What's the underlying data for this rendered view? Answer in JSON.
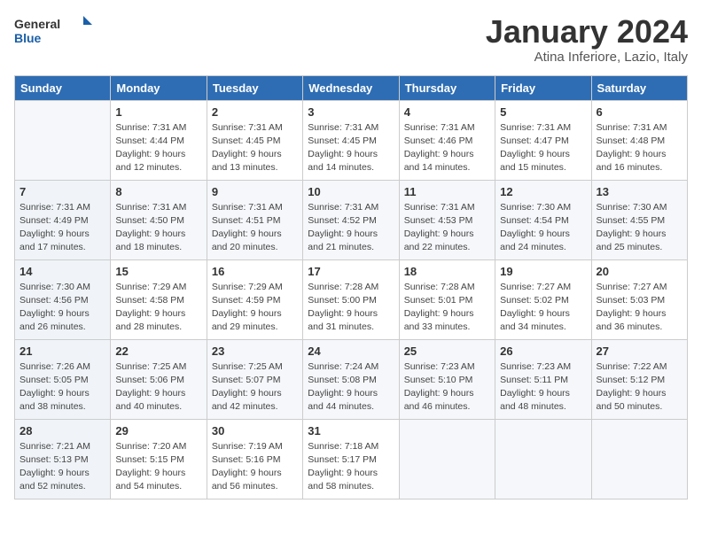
{
  "header": {
    "logo_line1": "General",
    "logo_line2": "Blue",
    "month_title": "January 2024",
    "location": "Atina Inferiore, Lazio, Italy"
  },
  "weekdays": [
    "Sunday",
    "Monday",
    "Tuesday",
    "Wednesday",
    "Thursday",
    "Friday",
    "Saturday"
  ],
  "weeks": [
    [
      {
        "day": "",
        "content": ""
      },
      {
        "day": "1",
        "content": "Sunrise: 7:31 AM\nSunset: 4:44 PM\nDaylight: 9 hours\nand 12 minutes."
      },
      {
        "day": "2",
        "content": "Sunrise: 7:31 AM\nSunset: 4:45 PM\nDaylight: 9 hours\nand 13 minutes."
      },
      {
        "day": "3",
        "content": "Sunrise: 7:31 AM\nSunset: 4:45 PM\nDaylight: 9 hours\nand 14 minutes."
      },
      {
        "day": "4",
        "content": "Sunrise: 7:31 AM\nSunset: 4:46 PM\nDaylight: 9 hours\nand 14 minutes."
      },
      {
        "day": "5",
        "content": "Sunrise: 7:31 AM\nSunset: 4:47 PM\nDaylight: 9 hours\nand 15 minutes."
      },
      {
        "day": "6",
        "content": "Sunrise: 7:31 AM\nSunset: 4:48 PM\nDaylight: 9 hours\nand 16 minutes."
      }
    ],
    [
      {
        "day": "7",
        "content": "Sunrise: 7:31 AM\nSunset: 4:49 PM\nDaylight: 9 hours\nand 17 minutes."
      },
      {
        "day": "8",
        "content": "Sunrise: 7:31 AM\nSunset: 4:50 PM\nDaylight: 9 hours\nand 18 minutes."
      },
      {
        "day": "9",
        "content": "Sunrise: 7:31 AM\nSunset: 4:51 PM\nDaylight: 9 hours\nand 20 minutes."
      },
      {
        "day": "10",
        "content": "Sunrise: 7:31 AM\nSunset: 4:52 PM\nDaylight: 9 hours\nand 21 minutes."
      },
      {
        "day": "11",
        "content": "Sunrise: 7:31 AM\nSunset: 4:53 PM\nDaylight: 9 hours\nand 22 minutes."
      },
      {
        "day": "12",
        "content": "Sunrise: 7:30 AM\nSunset: 4:54 PM\nDaylight: 9 hours\nand 24 minutes."
      },
      {
        "day": "13",
        "content": "Sunrise: 7:30 AM\nSunset: 4:55 PM\nDaylight: 9 hours\nand 25 minutes."
      }
    ],
    [
      {
        "day": "14",
        "content": "Sunrise: 7:30 AM\nSunset: 4:56 PM\nDaylight: 9 hours\nand 26 minutes."
      },
      {
        "day": "15",
        "content": "Sunrise: 7:29 AM\nSunset: 4:58 PM\nDaylight: 9 hours\nand 28 minutes."
      },
      {
        "day": "16",
        "content": "Sunrise: 7:29 AM\nSunset: 4:59 PM\nDaylight: 9 hours\nand 29 minutes."
      },
      {
        "day": "17",
        "content": "Sunrise: 7:28 AM\nSunset: 5:00 PM\nDaylight: 9 hours\nand 31 minutes."
      },
      {
        "day": "18",
        "content": "Sunrise: 7:28 AM\nSunset: 5:01 PM\nDaylight: 9 hours\nand 33 minutes."
      },
      {
        "day": "19",
        "content": "Sunrise: 7:27 AM\nSunset: 5:02 PM\nDaylight: 9 hours\nand 34 minutes."
      },
      {
        "day": "20",
        "content": "Sunrise: 7:27 AM\nSunset: 5:03 PM\nDaylight: 9 hours\nand 36 minutes."
      }
    ],
    [
      {
        "day": "21",
        "content": "Sunrise: 7:26 AM\nSunset: 5:05 PM\nDaylight: 9 hours\nand 38 minutes."
      },
      {
        "day": "22",
        "content": "Sunrise: 7:25 AM\nSunset: 5:06 PM\nDaylight: 9 hours\nand 40 minutes."
      },
      {
        "day": "23",
        "content": "Sunrise: 7:25 AM\nSunset: 5:07 PM\nDaylight: 9 hours\nand 42 minutes."
      },
      {
        "day": "24",
        "content": "Sunrise: 7:24 AM\nSunset: 5:08 PM\nDaylight: 9 hours\nand 44 minutes."
      },
      {
        "day": "25",
        "content": "Sunrise: 7:23 AM\nSunset: 5:10 PM\nDaylight: 9 hours\nand 46 minutes."
      },
      {
        "day": "26",
        "content": "Sunrise: 7:23 AM\nSunset: 5:11 PM\nDaylight: 9 hours\nand 48 minutes."
      },
      {
        "day": "27",
        "content": "Sunrise: 7:22 AM\nSunset: 5:12 PM\nDaylight: 9 hours\nand 50 minutes."
      }
    ],
    [
      {
        "day": "28",
        "content": "Sunrise: 7:21 AM\nSunset: 5:13 PM\nDaylight: 9 hours\nand 52 minutes."
      },
      {
        "day": "29",
        "content": "Sunrise: 7:20 AM\nSunset: 5:15 PM\nDaylight: 9 hours\nand 54 minutes."
      },
      {
        "day": "30",
        "content": "Sunrise: 7:19 AM\nSunset: 5:16 PM\nDaylight: 9 hours\nand 56 minutes."
      },
      {
        "day": "31",
        "content": "Sunrise: 7:18 AM\nSunset: 5:17 PM\nDaylight: 9 hours\nand 58 minutes."
      },
      {
        "day": "",
        "content": ""
      },
      {
        "day": "",
        "content": ""
      },
      {
        "day": "",
        "content": ""
      }
    ]
  ]
}
